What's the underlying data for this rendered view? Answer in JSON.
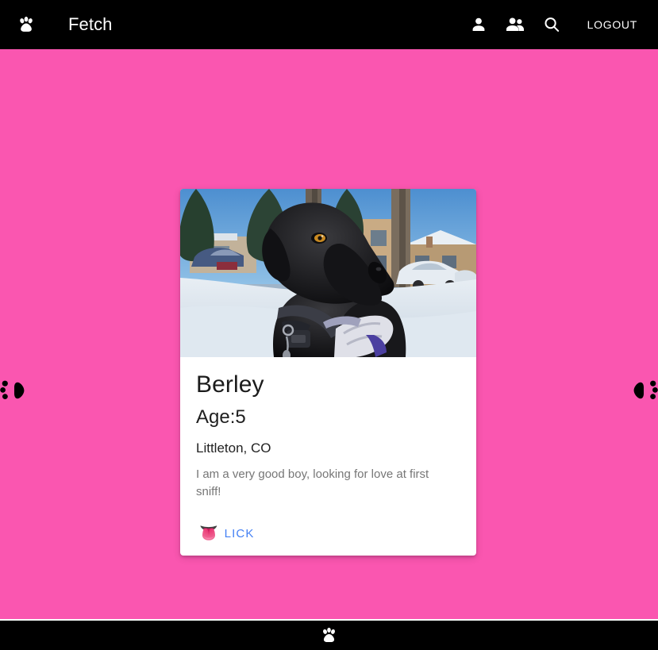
{
  "app": {
    "brand_title": "Fetch",
    "brand_icon": "paw-icon",
    "accent_pink": "#fa56b0",
    "toolbar_bg": "#000000",
    "link_blue": "#4581f4"
  },
  "toolbar": {
    "icons": [
      {
        "name": "person-icon",
        "label": "Profile"
      },
      {
        "name": "people-icon",
        "label": "Matches"
      },
      {
        "name": "search-icon",
        "label": "Search"
      }
    ],
    "logout_label": "LOGOUT"
  },
  "nav": {
    "prev_label": "Previous dog",
    "prev_icon": "paw-left-icon",
    "next_label": "Next dog",
    "next_icon": "paw-right-icon"
  },
  "card": {
    "photo_alt": "Black labrador dog standing in snow in front of apartment buildings",
    "name": "Berley",
    "age": "Age:5",
    "location": "Littleton, CO",
    "description": "I am a very good boy, looking for love at first sniff!",
    "action_emoji": "👅",
    "action_label": "LICK"
  },
  "footer": {
    "icon": "paw-icon"
  }
}
